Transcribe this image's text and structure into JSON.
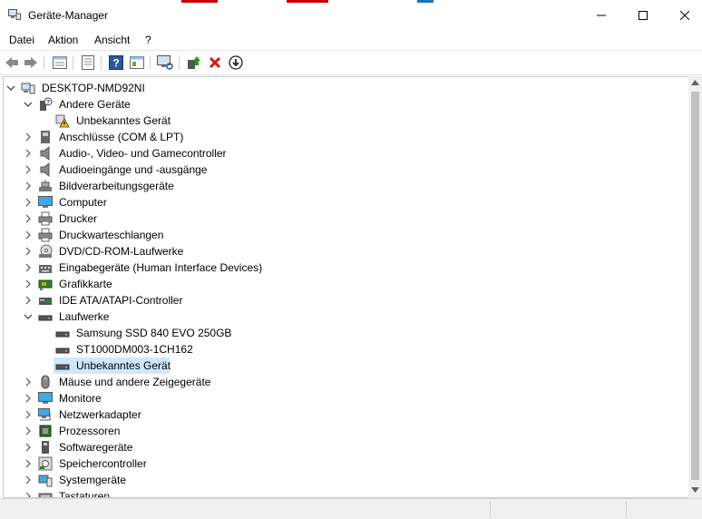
{
  "window": {
    "title": "Geräte-Manager",
    "accent_colors": [
      "#c00000",
      "#1e73be"
    ]
  },
  "menu": [
    {
      "label": "Datei"
    },
    {
      "label": "Aktion"
    },
    {
      "label": "Ansicht"
    },
    {
      "label": "?"
    }
  ],
  "toolbar": {
    "icons": [
      "back-icon",
      "forward-icon",
      "properties-icon",
      "view-icon",
      "help-icon",
      "details-icon",
      "scan-hardware-icon",
      "update-driver-icon",
      "uninstall-icon",
      "disable-icon"
    ]
  },
  "tree": {
    "root": {
      "label": "DESKTOP-NMD92NI",
      "icon": "computer-icon"
    },
    "items": [
      {
        "label": "Andere Geräte",
        "expanded": true,
        "icon": "unknown-device-icon",
        "children": [
          {
            "label": "Unbekanntes Gerät",
            "icon": "warning-device-icon"
          }
        ]
      },
      {
        "label": "Anschlüsse (COM & LPT)",
        "icon": "port-icon"
      },
      {
        "label": "Audio-, Video- und Gamecontroller",
        "icon": "speaker-icon"
      },
      {
        "label": "Audioeingänge und -ausgänge",
        "icon": "speaker-icon"
      },
      {
        "label": "Bildverarbeitungsgeräte",
        "icon": "camera-icon"
      },
      {
        "label": "Computer",
        "icon": "monitor-icon"
      },
      {
        "label": "Drucker",
        "icon": "printer-icon"
      },
      {
        "label": "Druckwarteschlangen",
        "icon": "printer-icon"
      },
      {
        "label": "DVD/CD-ROM-Laufwerke",
        "icon": "disc-drive-icon"
      },
      {
        "label": "Eingabegeräte (Human Interface Devices)",
        "icon": "hid-icon"
      },
      {
        "label": "Grafikkarte",
        "icon": "display-adapter-icon"
      },
      {
        "label": "IDE ATA/ATAPI-Controller",
        "icon": "ide-controller-icon"
      },
      {
        "label": "Laufwerke",
        "expanded": true,
        "icon": "drive-icon",
        "children": [
          {
            "label": "Samsung SSD 840 EVO 250GB",
            "icon": "drive-icon"
          },
          {
            "label": "ST1000DM003-1CH162",
            "icon": "drive-icon"
          },
          {
            "label": "Unbekanntes Gerät",
            "icon": "drive-icon",
            "selected": true
          }
        ]
      },
      {
        "label": "Mäuse und andere Zeigegeräte",
        "icon": "mouse-icon"
      },
      {
        "label": "Monitore",
        "icon": "monitor-icon"
      },
      {
        "label": "Netzwerkadapter",
        "icon": "network-icon"
      },
      {
        "label": "Prozessoren",
        "icon": "processor-icon"
      },
      {
        "label": "Softwaregeräte",
        "icon": "software-device-icon"
      },
      {
        "label": "Speichercontroller",
        "icon": "storage-controller-icon"
      },
      {
        "label": "Systemgeräte",
        "icon": "system-device-icon"
      },
      {
        "label": "Tastaturen",
        "icon": "keyboard-icon"
      }
    ]
  },
  "colors": {
    "selection": "#cce8ff",
    "scroll_thumb": "#c1c1c1",
    "help_blue": "#2b5797",
    "uninstall_red": "#d11919",
    "green": "#19a319"
  }
}
